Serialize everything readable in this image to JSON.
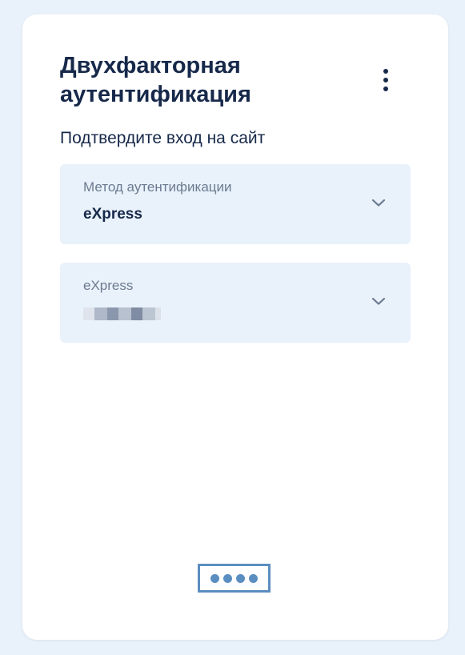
{
  "title": "Двухфакторная аутентификация",
  "subtitle": "Подтвердите вход на сайт",
  "menu_icon": "more-vertical-icon",
  "method_select": {
    "label": "Метод аутентификации",
    "value": "eXpress",
    "icon": "chevron-down-icon"
  },
  "express_select": {
    "label": "eXpress",
    "value_masked": true,
    "icon": "chevron-down-icon"
  },
  "footer_icon": "password-dots-icon",
  "colors": {
    "background": "#e9f1fa",
    "card": "#ffffff",
    "field_bg": "#e9f2fb",
    "text_dark": "#17294a",
    "text_muted": "#6c7a90",
    "accent": "#5b8ec0"
  }
}
